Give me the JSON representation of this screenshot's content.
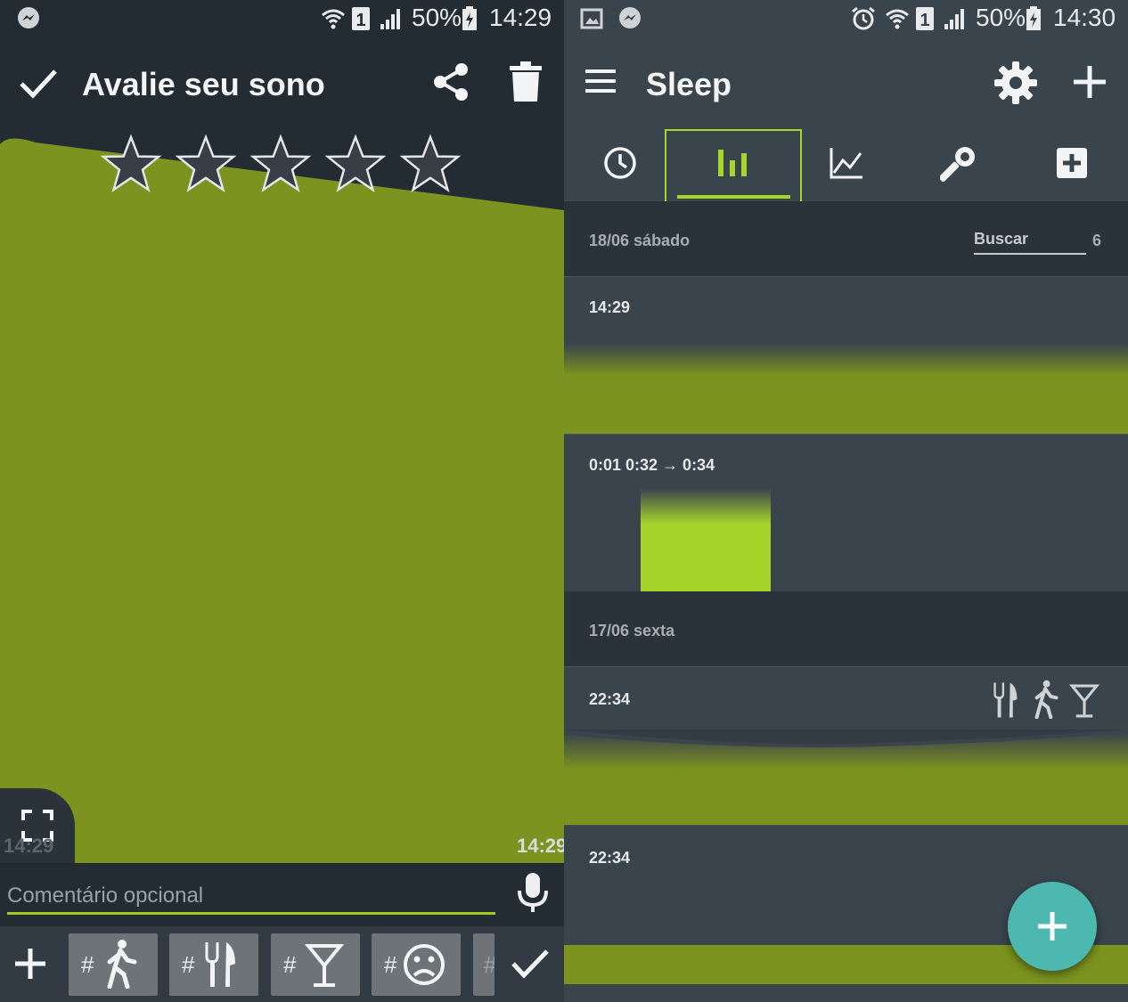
{
  "left": {
    "status_time": "14:29",
    "battery_pct": "50%",
    "sim_slot": "1",
    "title": "Avalie seu sono",
    "rating": 0,
    "rating_max": 5,
    "graph_start": "14:29",
    "graph_end": "14:29",
    "comment_placeholder": "Comentário opcional",
    "tags": [
      {
        "hash": "#",
        "icon": "walking-icon"
      },
      {
        "hash": "#",
        "icon": "food-icon"
      },
      {
        "hash": "#",
        "icon": "cocktail-icon"
      },
      {
        "hash": "#",
        "icon": "sad-face-icon"
      },
      {
        "hash": "#",
        "icon": "partial-tag"
      }
    ],
    "colors": {
      "graph": "#7c931f",
      "accent": "#9fcb1e",
      "background": "#232b33"
    }
  },
  "right": {
    "status_time": "14:30",
    "battery_pct": "50%",
    "sim_slot": "1",
    "title": "Sleep",
    "tabs": [
      "clock-icon",
      "bar-chart-icon",
      "line-chart-icon",
      "tools-icon",
      "add-box-icon"
    ],
    "selected_tab": 1,
    "search_label": "Buscar",
    "count": "6",
    "days": [
      {
        "date": "18/06 sábado",
        "records": [
          {
            "time": "14:29"
          },
          {
            "time": "0:01 0:32 → 0:34"
          }
        ]
      },
      {
        "date": "17/06 sexta",
        "records": [
          {
            "time": "22:34",
            "tags": [
              "food-icon",
              "walking-icon",
              "cocktail-icon"
            ]
          },
          {
            "time": "22:34"
          }
        ]
      }
    ],
    "colors": {
      "graph": "#7c931f",
      "bright": "#a6d42a",
      "fab": "#4db8b0"
    }
  }
}
